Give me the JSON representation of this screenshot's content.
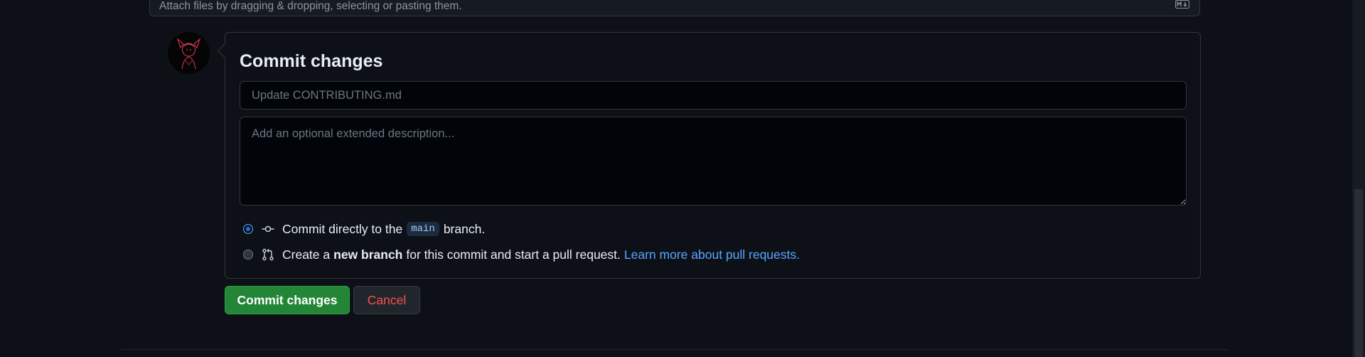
{
  "attach": {
    "text": "Attach files by dragging & dropping, selecting or pasting them.",
    "icon": "markdown-icon"
  },
  "avatar": {
    "icon": "user-avatar"
  },
  "commit": {
    "title": "Commit changes",
    "summary_placeholder": "Update CONTRIBUTING.md",
    "description_placeholder": "Add an optional extended description...",
    "options": {
      "direct": {
        "selected": true,
        "icon": "git-commit-icon",
        "prefix": "Commit directly to the",
        "branch": "main",
        "suffix": "branch."
      },
      "new_branch": {
        "selected": false,
        "icon": "git-pull-request-icon",
        "prefix": "Create a",
        "bold": "new branch",
        "suffix": "for this commit and start a pull request.",
        "link": "Learn more about pull requests."
      }
    }
  },
  "buttons": {
    "commit_label": "Commit changes",
    "cancel_label": "Cancel"
  },
  "colors": {
    "background": "#0d1117",
    "border": "#30363d",
    "primary_button": "#238636",
    "danger_text": "#f85149",
    "link": "#58a6ff"
  }
}
